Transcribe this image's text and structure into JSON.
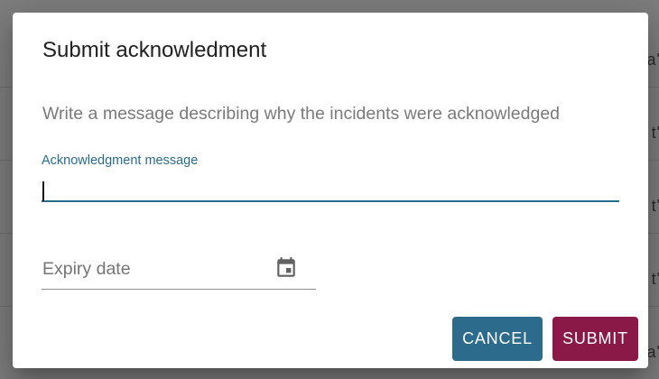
{
  "dialog": {
    "title": "Submit acknowledment",
    "description": "Write a message describing why the incidents were acknowledged",
    "message_field": {
      "label": "Acknowledgment message",
      "value": ""
    },
    "expiry_field": {
      "placeholder": "Expiry date",
      "icon": "calendar-icon"
    },
    "buttons": {
      "cancel_label": "CANCEL",
      "submit_label": "SUBMIT"
    }
  },
  "background": {
    "row_glyphs": [
      "a'",
      "t'",
      "t'",
      "t'",
      "a'"
    ]
  },
  "colors": {
    "primary": "#2d6b8c",
    "accent": "#8a1947",
    "backdrop": "#7d7d7d"
  }
}
